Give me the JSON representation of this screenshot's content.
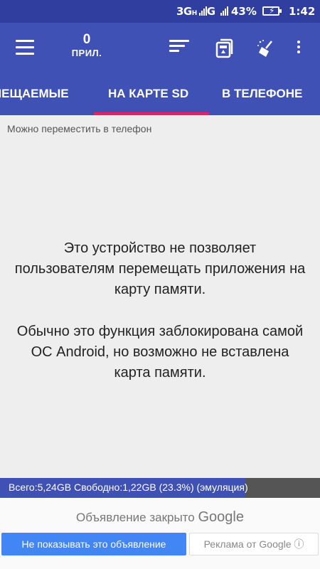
{
  "status_bar": {
    "network_1": "3G",
    "network_2": "G",
    "battery_percent": "43%",
    "time": "1:42"
  },
  "app_bar": {
    "apps_count": "0",
    "apps_label": "ПРИЛ.",
    "icons": [
      "menu-icon",
      "sort-icon",
      "sd-card-icon",
      "broom-icon",
      "more-vert-icon"
    ]
  },
  "tabs": [
    {
      "label": "МЕЩАЕМЫЕ"
    },
    {
      "label": "НА КАРТЕ SD",
      "selected": true
    },
    {
      "label": "В ТЕЛЕФОНЕ"
    }
  ],
  "section_label": "Можно переместить в телефон",
  "message": {
    "line1": "Это устройство не позволяет пользователям перемещать приложения на карту памяти.",
    "line2": "Обычно это функция заблокирована самой ОС Android, но возможно не вставлена карта памяти."
  },
  "storage": {
    "text": "Всего:5,24GB Свободно:1,22GB (23.3%) (эмуляция)",
    "used_fraction": 0.767
  },
  "ad": {
    "closed_text": "Объявление закрыто",
    "brand": "Google",
    "hide_button": "Не показывать это объявление",
    "info_button": "Реклама от Google ⓘ"
  },
  "colors": {
    "primary": "#3f51b5",
    "primary_dark": "#303f9f",
    "accent": "#e91e63",
    "ad_button": "#4285f4"
  }
}
